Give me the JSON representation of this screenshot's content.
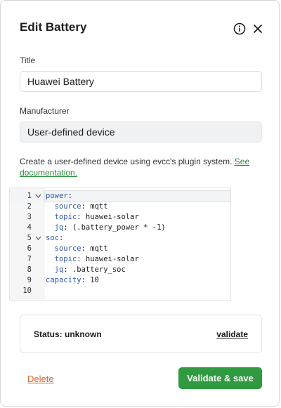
{
  "modal": {
    "title": "Edit Battery"
  },
  "form": {
    "title_label": "Title",
    "title_value": "Huawei Battery",
    "manufacturer_label": "Manufacturer",
    "manufacturer_value": "User-defined device",
    "description": "Create a user-defined device using evcc's plugin system.",
    "doc_link": "See documentation."
  },
  "editor": {
    "lines": [
      {
        "n": "1",
        "fold": "v",
        "indent": "",
        "key": "power",
        "value": ""
      },
      {
        "n": "2",
        "fold": "",
        "indent": "  ",
        "key": "source",
        "value": "mqtt"
      },
      {
        "n": "3",
        "fold": "",
        "indent": "  ",
        "key": "topic",
        "value": "huawei-solar"
      },
      {
        "n": "4",
        "fold": "",
        "indent": "  ",
        "key": "jq",
        "value": "(.battery_power * -1)"
      },
      {
        "n": "5",
        "fold": "v",
        "indent": "",
        "key": "soc",
        "value": ""
      },
      {
        "n": "6",
        "fold": "",
        "indent": "  ",
        "key": "source",
        "value": "mqtt"
      },
      {
        "n": "7",
        "fold": "",
        "indent": "  ",
        "key": "topic",
        "value": "huawei-solar"
      },
      {
        "n": "8",
        "fold": "",
        "indent": "  ",
        "key": "jq",
        "value": ".battery_soc"
      },
      {
        "n": "9",
        "fold": "",
        "indent": "",
        "key": "capacity",
        "value": "10"
      },
      {
        "n": "10",
        "fold": "",
        "indent": "",
        "key": "",
        "value": ""
      }
    ]
  },
  "status": {
    "text": "Status: unknown",
    "validate_label": "validate"
  },
  "footer": {
    "delete_label": "Delete",
    "save_label": "Validate & save"
  },
  "colors": {
    "primary": "#2f9a3f",
    "danger": "#d9632b",
    "yaml_key": "#2b57a8"
  },
  "icons": {
    "info": "info-icon",
    "close": "close-icon",
    "fold": "chevron-down-icon"
  }
}
